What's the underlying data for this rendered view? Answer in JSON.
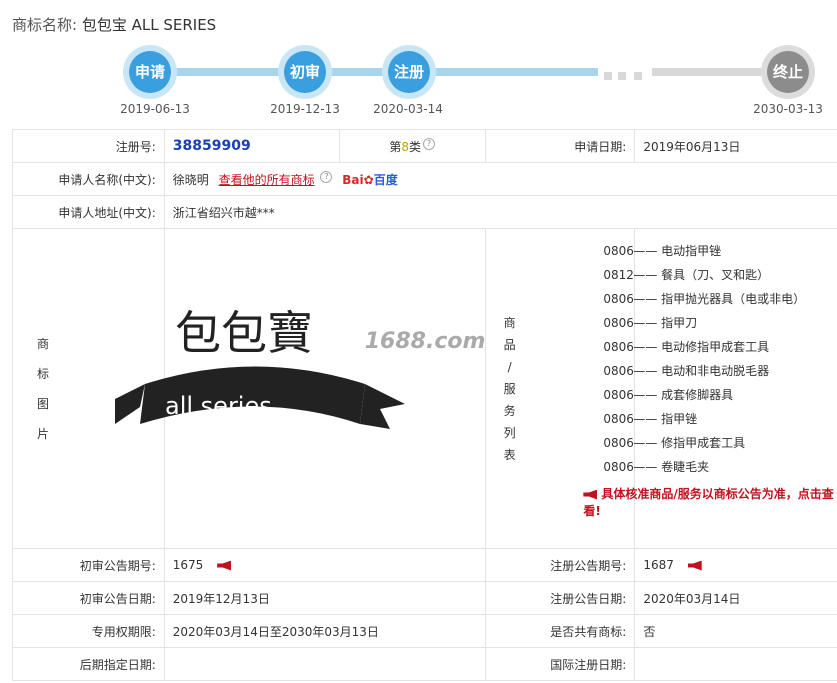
{
  "header": {
    "label": "商标名称:",
    "name": "包包宝 ALL SERIES"
  },
  "timeline": [
    {
      "label": "申请",
      "date": "2019-06-13"
    },
    {
      "label": "初审",
      "date": "2019-12-13"
    },
    {
      "label": "注册",
      "date": "2020-03-14"
    },
    {
      "label": "终止",
      "date": "2030-03-13"
    }
  ],
  "info": {
    "reg_no_label": "注册号:",
    "reg_no": "38859909",
    "class_prefix": "第",
    "class_num": "8",
    "class_suffix": "类",
    "apply_date_label": "申请日期:",
    "apply_date": "2019年06月13日",
    "applicant_label": "申请人名称(中文):",
    "applicant": "徐晓明",
    "all_marks_link": "查看他的所有商标",
    "baidu_text": "Bai",
    "baidu_cn": "百度",
    "address_label": "申请人地址(中文):",
    "address": "浙江省绍兴市越***",
    "image_label": [
      "商",
      "标",
      "图",
      "片"
    ],
    "goods_label": [
      "商",
      "品",
      "/",
      "服",
      "务",
      "列",
      "表"
    ],
    "logo_text_cn": "包包寶",
    "logo_ribbon": "all series",
    "watermark": "1688.com"
  },
  "goods": [
    {
      "code": "0806",
      "name": "电动指甲锉"
    },
    {
      "code": "0812",
      "name": "餐具（刀、叉和匙）"
    },
    {
      "code": "0806",
      "name": "指甲抛光器具（电或非电）"
    },
    {
      "code": "0806",
      "name": "指甲刀"
    },
    {
      "code": "0806",
      "name": "电动修指甲成套工具"
    },
    {
      "code": "0806",
      "name": "电动和非电动脱毛器"
    },
    {
      "code": "0806",
      "name": "成套修脚器具"
    },
    {
      "code": "0806",
      "name": "指甲锉"
    },
    {
      "code": "0806",
      "name": "修指甲成套工具"
    },
    {
      "code": "0806",
      "name": "卷睫毛夹"
    }
  ],
  "goods_notice": "具体核准商品/服务以商标公告为准，点击查看!",
  "bottom": {
    "prelim_no_label": "初审公告期号:",
    "prelim_no": "1675",
    "reg_pub_no_label": "注册公告期号:",
    "reg_pub_no": "1687",
    "prelim_date_label": "初审公告日期:",
    "prelim_date": "2019年12月13日",
    "reg_pub_date_label": "注册公告日期:",
    "reg_pub_date": "2020年03月14日",
    "exclusive_label": "专用权期限:",
    "exclusive": "2020年03月14日至2030年03月13日",
    "shared_label": "是否共有商标:",
    "shared": "否",
    "later_label": "后期指定日期:",
    "later": "",
    "intl_label": "国际注册日期:",
    "intl": ""
  }
}
